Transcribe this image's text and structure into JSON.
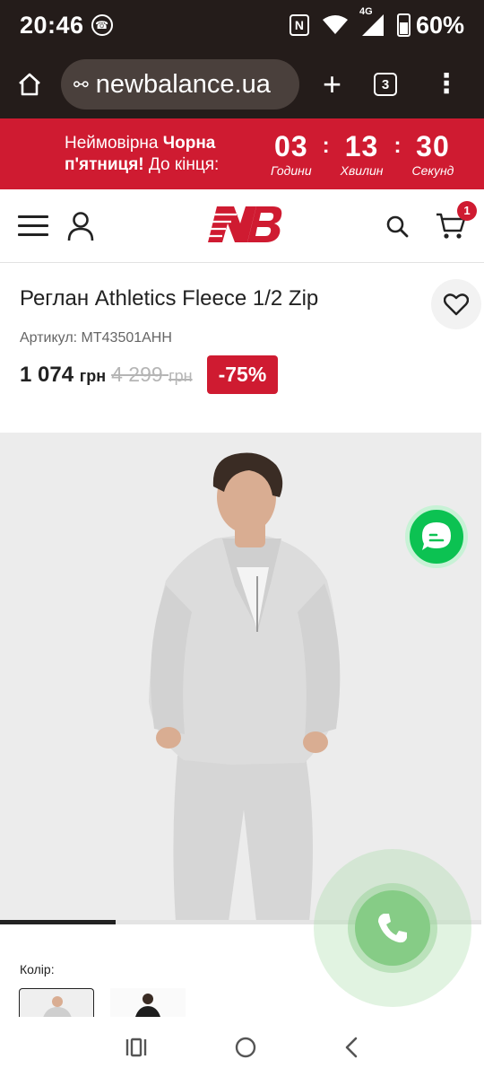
{
  "status_bar": {
    "time": "20:46",
    "network": "4G",
    "battery": "60%",
    "icons": [
      "viber-icon",
      "nfc-icon",
      "wifi-icon",
      "signal-icon",
      "battery-icon"
    ]
  },
  "browser": {
    "url": "newbalance.ua",
    "tab_count": "3"
  },
  "promo": {
    "text_prefix": "Неймовірна ",
    "text_bold_1": "Чорна",
    "text_bold_2": "п'ятниця!",
    "text_suffix": " До кінця:",
    "countdown": [
      {
        "value": "03",
        "label": "Години"
      },
      {
        "value": "13",
        "label": "Хвилин"
      },
      {
        "value": "30",
        "label": "Секунд"
      }
    ],
    "separator": ":",
    "background": "#cf1b31"
  },
  "header": {
    "cart_count": "1",
    "brand_color": "#cf1b31"
  },
  "product": {
    "title": "Реглан Athletics Fleece 1/2 Zip",
    "sku": "Артикул: MT43501AHH",
    "price_new": "1 074",
    "price_old": "4 299",
    "currency": "грн",
    "discount": "-75%"
  },
  "gallery": {
    "progress_fraction": 0.24
  },
  "colors": {
    "label": "Колір:"
  },
  "fabs": {
    "chat_color": "#0cc252",
    "call_color": "#86cc86"
  }
}
